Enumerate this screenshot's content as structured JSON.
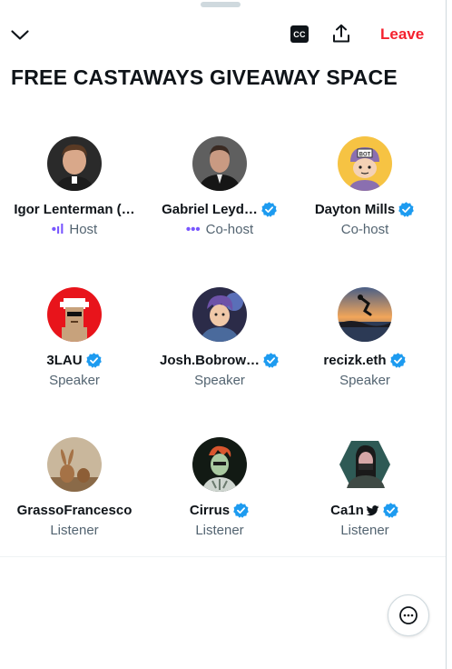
{
  "header": {
    "collapse_icon": "chevron-down-icon",
    "captions_label": "CC",
    "share_icon": "share-icon",
    "leave_label": "Leave",
    "leave_color": "#f4212e"
  },
  "space_title": "FREE CASTAWAYS GIVEAWAY SPACE",
  "participants": [
    {
      "name": "Igor Lenterman (…",
      "role": "Host",
      "verified": false,
      "speaking_indicator": true
    },
    {
      "name": "Gabriel Leyd…",
      "role": "Co-host",
      "verified": true,
      "speaking_indicator": true
    },
    {
      "name": "Dayton Mills",
      "role": "Co-host",
      "verified": true,
      "speaking_indicator": false
    },
    {
      "name": "3LAU",
      "role": "Speaker",
      "verified": true,
      "speaking_indicator": false
    },
    {
      "name": "Josh.Bobrow…",
      "role": "Speaker",
      "verified": true,
      "speaking_indicator": false
    },
    {
      "name": "recizk.eth",
      "role": "Speaker",
      "verified": true,
      "speaking_indicator": false
    },
    {
      "name": "GrassoFrancesco",
      "role": "Listener",
      "verified": false,
      "speaking_indicator": false
    },
    {
      "name": "Cirrus",
      "role": "Listener",
      "verified": true,
      "speaking_indicator": false
    },
    {
      "name": "Ca1n",
      "role": "Listener",
      "verified": true,
      "speaking_indicator": false
    }
  ],
  "speaking_dots": "•ıl",
  "cohost_dots": "•••",
  "chat_icon": "more-options-icon",
  "verified_color": "#1d9bf0",
  "accent_color": "#7856ff"
}
